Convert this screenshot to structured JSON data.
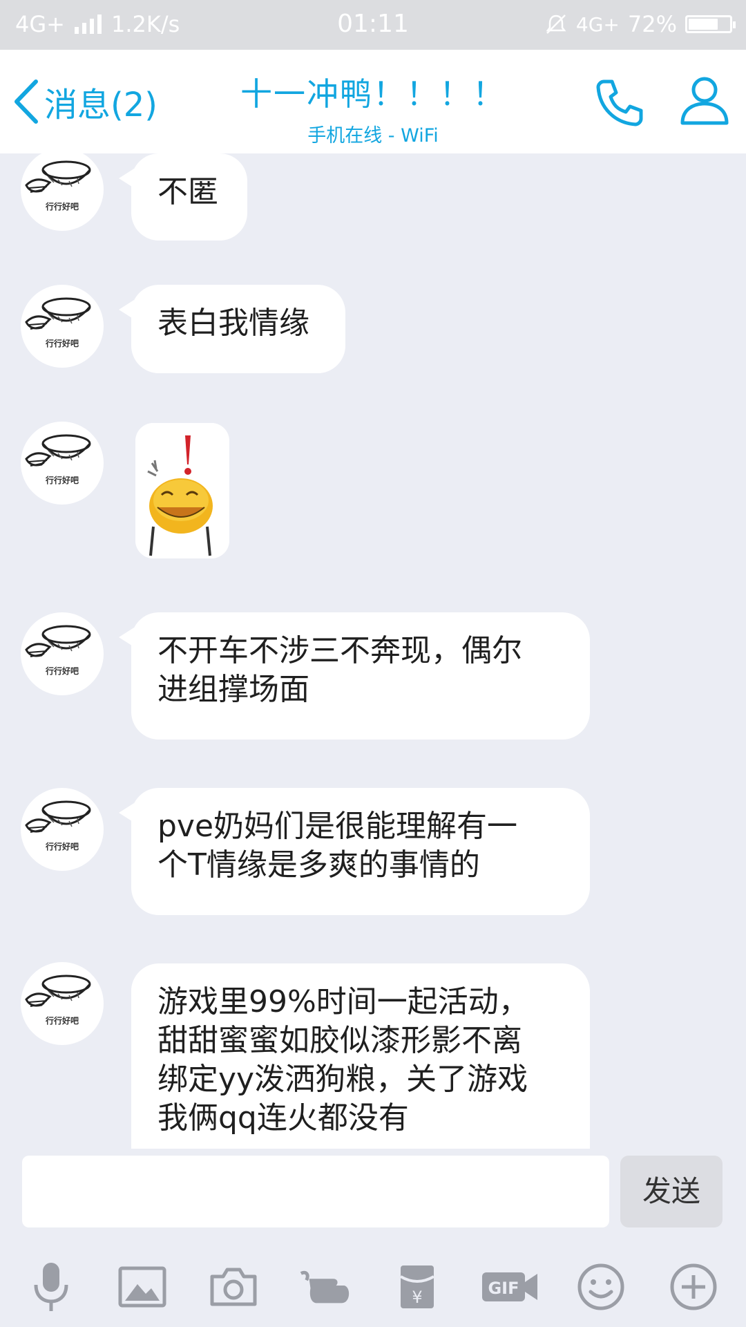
{
  "status_bar": {
    "network_left": "4G+",
    "speed": "1.2K/s",
    "time": "01:11",
    "network_right": "4G+",
    "battery": "72%",
    "battery_level": 0.72
  },
  "header": {
    "back_label": "消息(2)",
    "title": "十一冲鸭！！！！",
    "subtitle": "手机在线 - WiFi",
    "accent_color": "#12a6e0"
  },
  "messages": [
    {
      "type": "text",
      "lines": [
        "不匿"
      ]
    },
    {
      "type": "text",
      "lines": [
        "表白我情缘"
      ]
    },
    {
      "type": "sticker",
      "icon": "laughing-emoji-sticker"
    },
    {
      "type": "text",
      "lines": [
        "不开车不涉三不奔现，偶尔",
        "进组撑场面"
      ]
    },
    {
      "type": "text",
      "lines": [
        "pve奶妈们是很能理解有一",
        "个T情缘是多爽的事情的"
      ]
    },
    {
      "type": "text",
      "lines": [
        "游戏里99%时间一起活动，",
        "甜甜蜜蜜如胶似漆形影不离",
        "绑定yy泼洒狗粮，关了游戏",
        "我俩qq连火都没有"
      ]
    }
  ],
  "avatar_caption": "行行好吧",
  "composer": {
    "input_value": "",
    "send_label": "发送"
  },
  "toolbar": {
    "icons": [
      "microphone-icon",
      "image-icon",
      "camera-icon",
      "poke-hand-icon",
      "red-packet-icon",
      "gif-icon",
      "emoji-icon",
      "plus-icon"
    ],
    "gif_label": "GIF",
    "red_packet_symbol": "¥"
  }
}
